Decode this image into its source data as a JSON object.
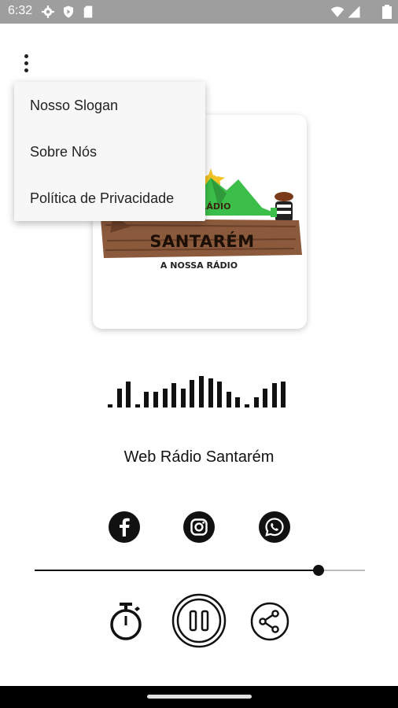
{
  "status_bar": {
    "time": "6:32",
    "icons": [
      "settings-icon",
      "shield-icon",
      "sd-card-icon",
      "wifi-icon",
      "signal-icon",
      "battery-icon"
    ]
  },
  "menu": {
    "items": [
      {
        "label": "Nosso Slogan"
      },
      {
        "label": "Sobre Nós"
      },
      {
        "label": "Política de Privacidade"
      }
    ]
  },
  "album": {
    "logo_line1": "WEB RÁDIO",
    "logo_line2": "SANTARÉM",
    "logo_line3": "A NOSSA RÁDIO"
  },
  "station": {
    "title": "Web Rádio Santarém"
  },
  "equalizer": {
    "levels": [
      0.1,
      0.55,
      0.75,
      0.1,
      0.45,
      0.45,
      0.55,
      0.7,
      0.55,
      0.8,
      0.9,
      0.85,
      0.75,
      0.45,
      0.3,
      0.1,
      0.3,
      0.55,
      0.7,
      0.75
    ]
  },
  "social": [
    "facebook-icon",
    "instagram-icon",
    "whatsapp-icon"
  ],
  "volume": {
    "level": 0.86
  },
  "controls": [
    "timer-icon",
    "pause-icon",
    "share-icon"
  ],
  "colors": {
    "status_bar": "#9e9e9e",
    "foreground": "#111111",
    "menu_bg": "#f7f7f7",
    "mountain_green": "#3cbf4a",
    "wood": "#8b5a3c"
  }
}
